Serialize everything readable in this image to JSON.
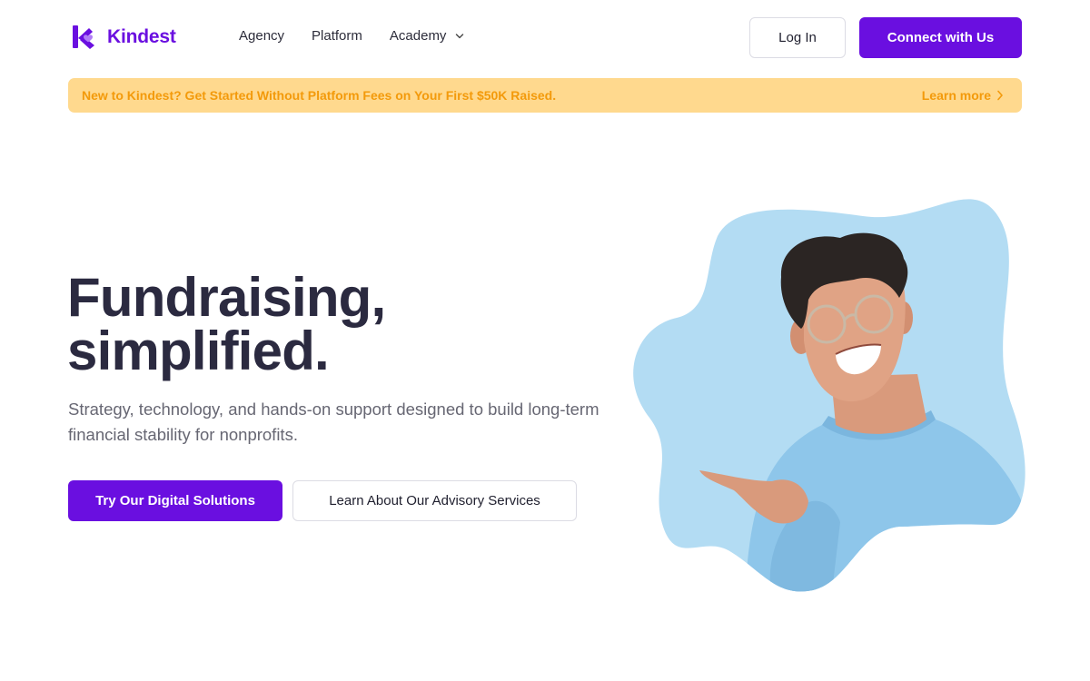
{
  "brand": {
    "name": "Kindest",
    "logo_icon": "kindest-k-heart-logo"
  },
  "nav": {
    "items": [
      {
        "label": "Agency"
      },
      {
        "label": "Platform"
      },
      {
        "label": "Academy",
        "icon": "chevron-down-icon"
      }
    ]
  },
  "header_actions": {
    "login_label": "Log In",
    "connect_label": "Connect with Us"
  },
  "announcement": {
    "text": "New to Kindest? Get Started Without Platform Fees on Your First $50K Raised.",
    "link_label": "Learn more",
    "link_icon": "chevron-right-icon"
  },
  "hero": {
    "title_line1": "Fundraising,",
    "title_line2": "simplified.",
    "subtitle": "Strategy, technology, and hands-on support designed to build long-term financial stability for nonprofits.",
    "primary_cta": "Try Our Digital Solutions",
    "secondary_cta": "Learn About Our Advisory Services",
    "image": "smiling-man-pointing-photo"
  },
  "colors": {
    "brand_purple": "#6a0fe0",
    "heading_navy": "#2b2a40",
    "banner_bg": "#ffd98e",
    "banner_text": "#f39a0b",
    "blob_blue": "#b3dcf3",
    "shirt_blue": "#8ec6ea"
  }
}
